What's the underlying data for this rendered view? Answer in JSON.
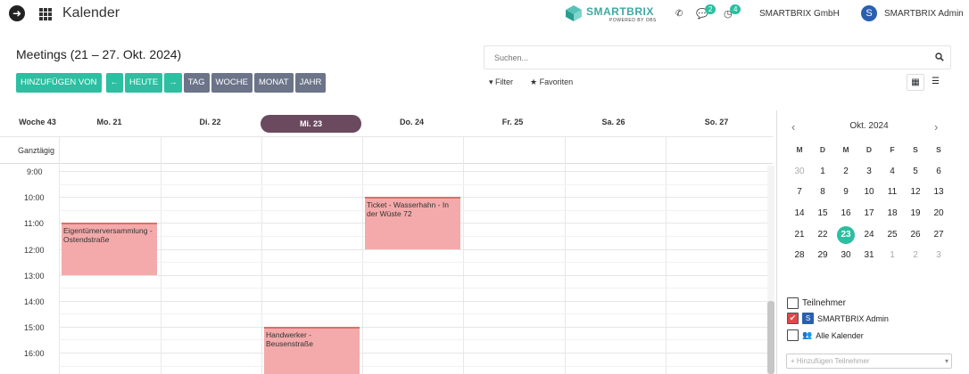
{
  "topbar": {
    "app_title": "Kalender",
    "logo_text": "SMARTBRIX",
    "logo_sub": "POWERED BY OBS",
    "messages_count": "2",
    "activities_count": "4",
    "company": "SMARTBRIX GmbH",
    "avatar_letter": "S",
    "username": "SMARTBRIX Admin",
    "icons": {
      "nav": "arrow-circle-icon",
      "apps": "grid-icon",
      "phone": "phone-icon",
      "messages": "chat-icon",
      "activities": "clock-icon"
    }
  },
  "page": {
    "title": "Meetings (21 – 27. Okt. 2024)"
  },
  "search": {
    "placeholder": "Suchen..."
  },
  "toolbar": {
    "add_label": "HINZUFÜGEN VON",
    "prev_label": "←",
    "today_label": "HEUTE",
    "next_label": "→",
    "day_label": "TAG",
    "week_label": "WOCHE",
    "month_label": "MONAT",
    "year_label": "JAHR",
    "filter_label": "Filter",
    "favorites_label": "Favoriten"
  },
  "calendar": {
    "week_label": "Woche 43",
    "days": [
      "Mo. 21",
      "Di. 22",
      "Mi. 23",
      "Do. 24",
      "Fr. 25",
      "Sa. 26",
      "So. 27"
    ],
    "today_index": 2,
    "allday_label": "Ganztägig",
    "hours": [
      "9:00",
      "10:00",
      "11:00",
      "12:00",
      "13:00",
      "14:00",
      "15:00",
      "16:00"
    ],
    "events": [
      {
        "title": "Eigentümerversammlung - Ostendstraße",
        "day": 0,
        "start": "11:00",
        "end": "13:00"
      },
      {
        "title": "Ticket - Wasserhahn - In der Wüste 72",
        "day": 3,
        "start": "10:00",
        "end": "12:00"
      },
      {
        "title": "Handwerker - Beusenstraße",
        "day": 2,
        "start": "15:00",
        "end": "17:00"
      }
    ]
  },
  "mini_calendar": {
    "title": "Okt. 2024",
    "prev": "‹",
    "next": "›",
    "dow": [
      "M",
      "D",
      "M",
      "D",
      "F",
      "S",
      "S"
    ],
    "weeks": [
      [
        "30",
        "1",
        "2",
        "3",
        "4",
        "5",
        "6"
      ],
      [
        "7",
        "8",
        "9",
        "10",
        "11",
        "12",
        "13"
      ],
      [
        "14",
        "15",
        "16",
        "17",
        "18",
        "19",
        "20"
      ],
      [
        "21",
        "22",
        "23",
        "24",
        "25",
        "26",
        "27"
      ],
      [
        "28",
        "29",
        "30",
        "31",
        "1",
        "2",
        "3"
      ]
    ],
    "selected": "23"
  },
  "attendees": {
    "header": "Teilnehmer",
    "items": [
      {
        "label": "SMARTBRIX Admin",
        "checked": true,
        "avatar": "S"
      },
      {
        "label": "Alle Kalender",
        "checked": false
      }
    ],
    "add_placeholder": "+ Hinzufügen Teilnehmer"
  }
}
